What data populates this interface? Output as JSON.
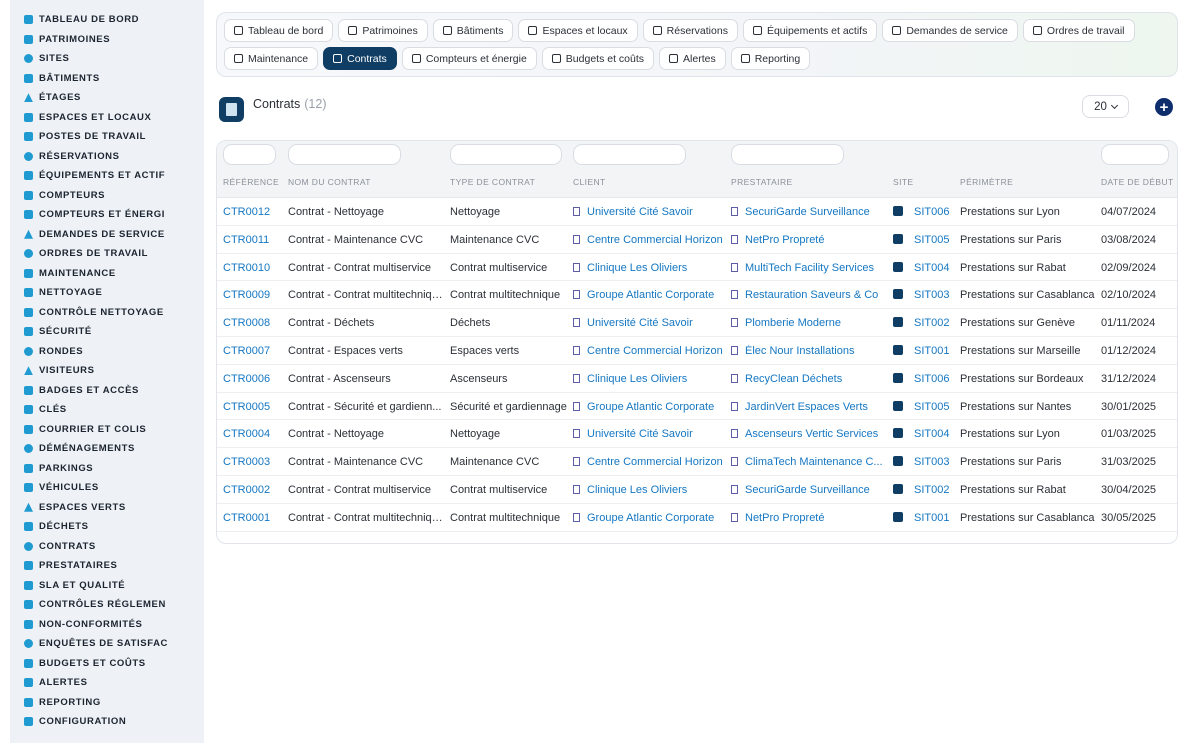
{
  "sidebar": {
    "items": [
      {
        "label": "TABLEAU DE BORD",
        "icon": "dashboard-icon"
      },
      {
        "label": "PATRIMOINES",
        "icon": "buildings-icon"
      },
      {
        "label": "SITES",
        "icon": "map-pin-icon"
      },
      {
        "label": "BÂTIMENTS",
        "icon": "building-icon"
      },
      {
        "label": "ÉTAGES",
        "icon": "layers-icon"
      },
      {
        "label": "ESPACES ET LOCAUX",
        "icon": "door-icon"
      },
      {
        "label": "POSTES DE TRAVAIL",
        "icon": "desktop-icon"
      },
      {
        "label": "RÉSERVATIONS",
        "icon": "calendar-icon"
      },
      {
        "label": "ÉQUIPEMENTS ET ACTIF",
        "icon": "gears-icon"
      },
      {
        "label": "COMPTEURS",
        "icon": "gauge-icon"
      },
      {
        "label": "COMPTEURS ET ÉNERGI",
        "icon": "bolt-icon"
      },
      {
        "label": "DEMANDES DE SERVICE",
        "icon": "clipboard-icon"
      },
      {
        "label": "ORDRES DE TRAVAIL",
        "icon": "tools-icon"
      },
      {
        "label": "MAINTENANCE",
        "icon": "wrench-icon"
      },
      {
        "label": "NETTOYAGE",
        "icon": "broom-icon"
      },
      {
        "label": "CONTRÔLE NETTOYAGE",
        "icon": "check-badge-icon"
      },
      {
        "label": "SÉCURITÉ",
        "icon": "shield-icon"
      },
      {
        "label": "RONDES",
        "icon": "route-icon"
      },
      {
        "label": "VISITEURS",
        "icon": "id-card-icon"
      },
      {
        "label": "BADGES ET ACCÈS",
        "icon": "badge-icon"
      },
      {
        "label": "CLÉS",
        "icon": "key-icon"
      },
      {
        "label": "COURRIER ET COLIS",
        "icon": "mailbox-icon"
      },
      {
        "label": "DÉMÉNAGEMENTS",
        "icon": "dolly-icon"
      },
      {
        "label": "PARKINGS",
        "icon": "parking-icon"
      },
      {
        "label": "VÉHICULES",
        "icon": "car-icon"
      },
      {
        "label": "ESPACES VERTS",
        "icon": "leaf-icon"
      },
      {
        "label": "DÉCHETS",
        "icon": "trash-icon"
      },
      {
        "label": "CONTRATS",
        "icon": "file-contract-icon"
      },
      {
        "label": "PRESTATAIRES",
        "icon": "handshake-icon"
      },
      {
        "label": "SLA ET QUALITÉ",
        "icon": "stopwatch-icon"
      },
      {
        "label": "CONTRÔLES RÉGLEMEN",
        "icon": "list-check-icon"
      },
      {
        "label": "NON-CONFORMITÉS",
        "icon": "ban-icon"
      },
      {
        "label": "ENQUÊTES DE SATISFAC",
        "icon": "star-icon"
      },
      {
        "label": "BUDGETS ET COÛTS",
        "icon": "coins-icon"
      },
      {
        "label": "ALERTES",
        "icon": "bell-icon"
      },
      {
        "label": "REPORTING",
        "icon": "chart-pie-icon"
      },
      {
        "label": "CONFIGURATION",
        "icon": "cog-icon"
      }
    ]
  },
  "nav": {
    "row1": [
      {
        "label": "Tableau de bord",
        "icon": "dashboard-icon"
      },
      {
        "label": "Patrimoines",
        "icon": "buildings-icon"
      },
      {
        "label": "Bâtiments",
        "icon": "building-icon"
      },
      {
        "label": "Espaces et locaux",
        "icon": "door-icon"
      },
      {
        "label": "Réservations",
        "icon": "calendar-icon"
      },
      {
        "label": "Équipements et actifs",
        "icon": "gears-icon"
      },
      {
        "label": "Demandes de service",
        "icon": "clipboard-icon"
      },
      {
        "label": "Ordres de travail",
        "icon": "tools-icon"
      }
    ],
    "row2": [
      {
        "label": "Maintenance",
        "icon": "wrench-icon"
      },
      {
        "label": "Contrats",
        "icon": "file-contract-icon"
      },
      {
        "label": "Compteurs et énergie",
        "icon": "bolt-icon"
      },
      {
        "label": "Budgets et coûts",
        "icon": "coins-icon"
      },
      {
        "label": "Alertes",
        "icon": "bell-icon"
      },
      {
        "label": "Reporting",
        "icon": "chart-pie-icon"
      }
    ],
    "active": "Contrats"
  },
  "page": {
    "title": "Contrats",
    "count": "(12)",
    "per_page": "20",
    "add_label": "+"
  },
  "table": {
    "columns": [
      "RÉFÉRENCE",
      "NOM DU CONTRAT",
      "TYPE DE CONTRAT",
      "CLIENT",
      "PRESTATAIRE",
      "SITE",
      "PÉRIMÈTRE",
      "DATE DE DÉBUT"
    ],
    "rows": [
      {
        "ref": "CTR0012",
        "name": "Contrat - Nettoyage",
        "type": "Nettoyage",
        "client": "Université Cité Savoir",
        "provider": "SecuriGarde Surveillance",
        "site": "SIT006",
        "scope": "Prestations sur Lyon",
        "start": "04/07/2024"
      },
      {
        "ref": "CTR0011",
        "name": "Contrat - Maintenance CVC",
        "type": "Maintenance CVC",
        "client": "Centre Commercial Horizon",
        "provider": "NetPro Propreté",
        "site": "SIT005",
        "scope": "Prestations sur Paris",
        "start": "03/08/2024"
      },
      {
        "ref": "CTR0010",
        "name": "Contrat - Contrat multiservice",
        "type": "Contrat multiservice",
        "client": "Clinique Les Oliviers",
        "provider": "MultiTech Facility Services",
        "site": "SIT004",
        "scope": "Prestations sur Rabat",
        "start": "02/09/2024"
      },
      {
        "ref": "CTR0009",
        "name": "Contrat - Contrat multitechnique",
        "type": "Contrat multitechnique",
        "client": "Groupe Atlantic Corporate",
        "provider": "Restauration Saveurs & Co",
        "site": "SIT003",
        "scope": "Prestations sur Casablanca",
        "start": "02/10/2024"
      },
      {
        "ref": "CTR0008",
        "name": "Contrat - Déchets",
        "type": "Déchets",
        "client": "Université Cité Savoir",
        "provider": "Plomberie Moderne",
        "site": "SIT002",
        "scope": "Prestations sur Genève",
        "start": "01/11/2024"
      },
      {
        "ref": "CTR0007",
        "name": "Contrat - Espaces verts",
        "type": "Espaces verts",
        "client": "Centre Commercial Horizon",
        "provider": "Élec Nour Installations",
        "site": "SIT001",
        "scope": "Prestations sur Marseille",
        "start": "01/12/2024"
      },
      {
        "ref": "CTR0006",
        "name": "Contrat - Ascenseurs",
        "type": "Ascenseurs",
        "client": "Clinique Les Oliviers",
        "provider": "RecyClean Déchets",
        "site": "SIT006",
        "scope": "Prestations sur Bordeaux",
        "start": "31/12/2024"
      },
      {
        "ref": "CTR0005",
        "name": "Contrat - Sécurité et gardienn...",
        "type": "Sécurité et gardiennage",
        "client": "Groupe Atlantic Corporate",
        "provider": "JardinVert Espaces Verts",
        "site": "SIT005",
        "scope": "Prestations sur Nantes",
        "start": "30/01/2025"
      },
      {
        "ref": "CTR0004",
        "name": "Contrat - Nettoyage",
        "type": "Nettoyage",
        "client": "Université Cité Savoir",
        "provider": "Ascenseurs Vertic Services",
        "site": "SIT004",
        "scope": "Prestations sur Lyon",
        "start": "01/03/2025"
      },
      {
        "ref": "CTR0003",
        "name": "Contrat - Maintenance CVC",
        "type": "Maintenance CVC",
        "client": "Centre Commercial Horizon",
        "provider": "ClimaTech Maintenance C...",
        "site": "SIT003",
        "scope": "Prestations sur Paris",
        "start": "31/03/2025"
      },
      {
        "ref": "CTR0002",
        "name": "Contrat - Contrat multiservice",
        "type": "Contrat multiservice",
        "client": "Clinique Les Oliviers",
        "provider": "SecuriGarde Surveillance",
        "site": "SIT002",
        "scope": "Prestations sur Rabat",
        "start": "30/04/2025"
      },
      {
        "ref": "CTR0001",
        "name": "Contrat - Contrat multitechnique",
        "type": "Contrat multitechnique",
        "client": "Groupe Atlantic Corporate",
        "provider": "NetPro Propreté",
        "site": "SIT001",
        "scope": "Prestations sur Casablanca",
        "start": "30/05/2025"
      }
    ]
  }
}
